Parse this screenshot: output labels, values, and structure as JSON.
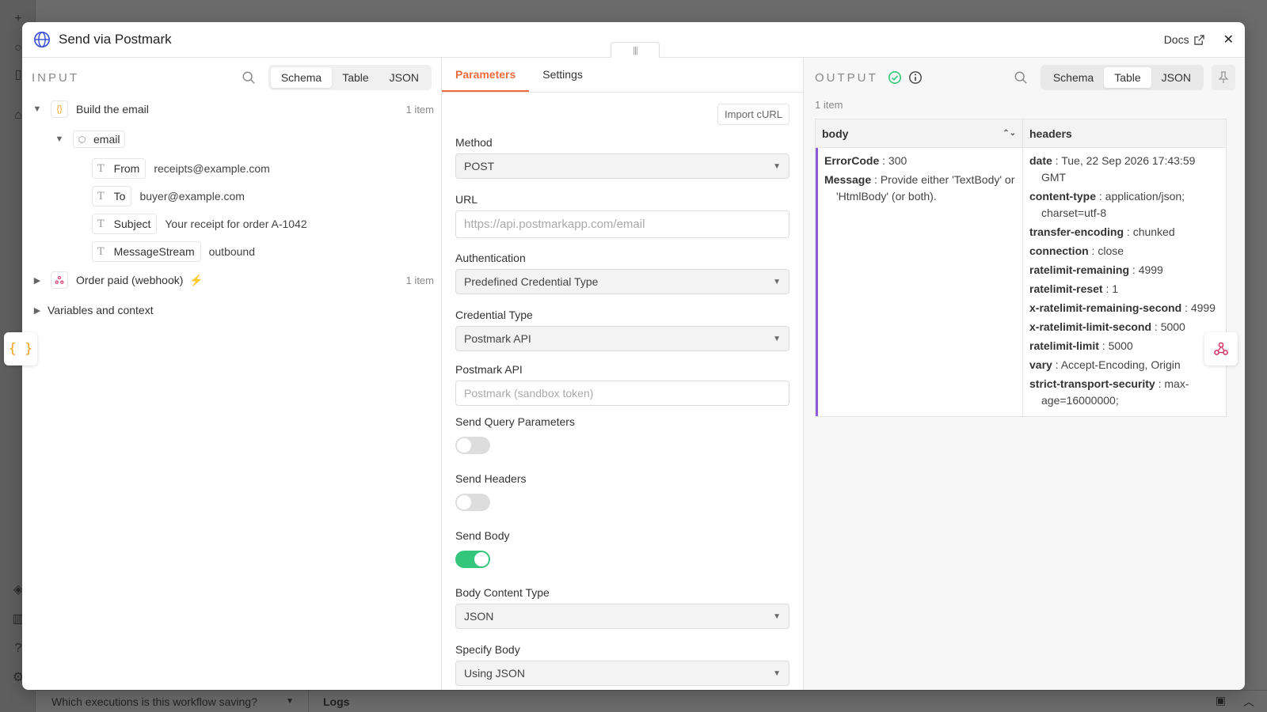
{
  "background": {
    "bottom_question": "Which executions is this workflow saving?",
    "bottom_logs": "Logs"
  },
  "modal": {
    "title": "Send via Postmark",
    "docs_label": "Docs",
    "drag_handle": "|||"
  },
  "input": {
    "label": "INPUT",
    "views": [
      "Schema",
      "Table",
      "JSON"
    ],
    "active_view": "Schema",
    "build_email": {
      "name": "Build the email",
      "count": "1 item"
    },
    "email_node": "email",
    "fields": [
      {
        "key": "From",
        "value": "receipts@example.com"
      },
      {
        "key": "To",
        "value": "buyer@example.com"
      },
      {
        "key": "Subject",
        "value": "Your receipt for order A-1042"
      },
      {
        "key": "MessageStream",
        "value": "outbound"
      }
    ],
    "order_paid": {
      "name": "Order paid (webhook)",
      "count": "1 item"
    },
    "variables": "Variables and context"
  },
  "params": {
    "tabs": [
      "Parameters",
      "Settings"
    ],
    "import_curl": "Import cURL",
    "method_label": "Method",
    "method_value": "POST",
    "url_label": "URL",
    "url_placeholder": "https://api.postmarkapp.com/email",
    "auth_label": "Authentication",
    "auth_value": "Predefined Credential Type",
    "cred_type_label": "Credential Type",
    "cred_type_value": "Postmark API",
    "postmark_label": "Postmark API",
    "postmark_placeholder": "Postmark (sandbox token)",
    "send_query_label": "Send Query Parameters",
    "send_query_on": false,
    "send_headers_label": "Send Headers",
    "send_headers_on": false,
    "send_body_label": "Send Body",
    "send_body_on": true,
    "body_type_label": "Body Content Type",
    "body_type_value": "JSON",
    "specify_body_label": "Specify Body",
    "specify_body_value": "Using JSON"
  },
  "output": {
    "label": "OUTPUT",
    "views": [
      "Schema",
      "Table",
      "JSON"
    ],
    "active_view": "Table",
    "count": "1 item",
    "columns": [
      "body",
      "headers"
    ],
    "body": [
      {
        "key": "ErrorCode",
        "value": "300"
      },
      {
        "key": "Message",
        "value": "Provide either 'TextBody' or 'HtmlBody' (or both)."
      }
    ],
    "headers": [
      {
        "key": "date",
        "value": "Tue, 22 Sep 2026 17:43:59 GMT"
      },
      {
        "key": "content-type",
        "value": "application/json; charset=utf-8"
      },
      {
        "key": "transfer-encoding",
        "value": "chunked"
      },
      {
        "key": "connection",
        "value": "close"
      },
      {
        "key": "ratelimit-remaining",
        "value": "4999"
      },
      {
        "key": "ratelimit-reset",
        "value": "1"
      },
      {
        "key": "x-ratelimit-remaining-second",
        "value": "4999"
      },
      {
        "key": "x-ratelimit-limit-second",
        "value": "5000"
      },
      {
        "key": "ratelimit-limit",
        "value": "5000"
      },
      {
        "key": "vary",
        "value": "Accept-Encoding, Origin"
      },
      {
        "key": "strict-transport-security",
        "value": "max-age=16000000;"
      }
    ]
  },
  "colors": {
    "accent": "#ef6c3e",
    "success": "#34c77b",
    "body_bar": "#8e5bd6",
    "brace": "#f0a020"
  }
}
